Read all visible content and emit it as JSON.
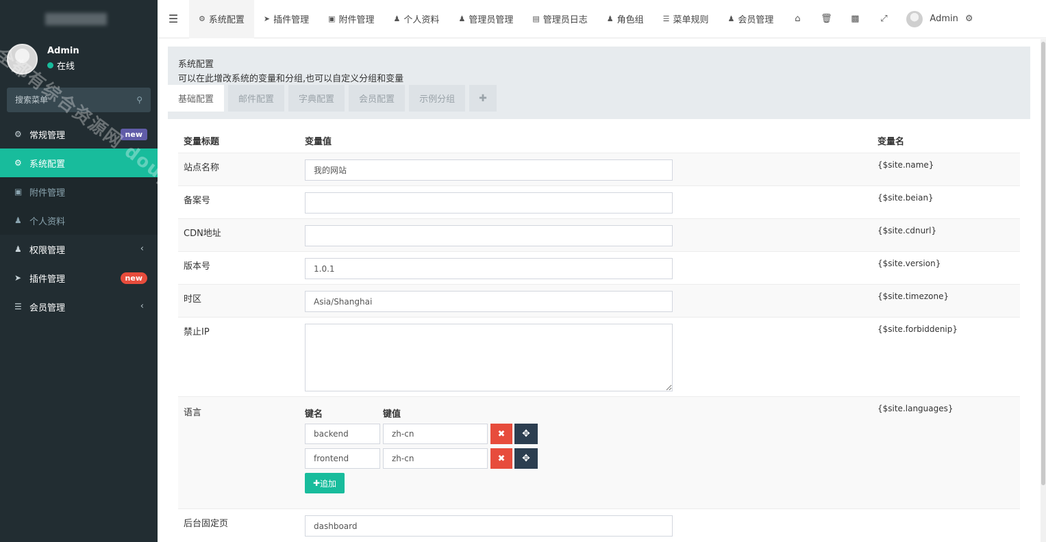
{
  "sidebar": {
    "user": {
      "name": "Admin",
      "status": "在线"
    },
    "search_placeholder": "搜索菜单",
    "items": [
      {
        "label": "常规管理",
        "icon": "cogs-icon",
        "badge": "new"
      },
      {
        "label": "系统配置",
        "icon": "gear-icon"
      },
      {
        "label": "附件管理",
        "icon": "file-image-icon"
      },
      {
        "label": "个人资料",
        "icon": "user-icon"
      },
      {
        "label": "权限管理",
        "icon": "group-icon"
      },
      {
        "label": "插件管理",
        "icon": "rocket-icon",
        "badge": "new"
      },
      {
        "label": "会员管理",
        "icon": "list-icon"
      }
    ],
    "watermark": "全都有综合资源网 douyouvip.com"
  },
  "topnav": {
    "tabs": [
      {
        "label": "系统配置",
        "icon": "gear-icon"
      },
      {
        "label": "插件管理",
        "icon": "rocket-icon"
      },
      {
        "label": "附件管理",
        "icon": "file-image-icon"
      },
      {
        "label": "个人资料",
        "icon": "user-icon"
      },
      {
        "label": "管理员管理",
        "icon": "user-icon"
      },
      {
        "label": "管理员日志",
        "icon": "list-alt-icon"
      },
      {
        "label": "角色组",
        "icon": "group-icon"
      },
      {
        "label": "菜单规则",
        "icon": "bars-icon"
      },
      {
        "label": "会员管理",
        "icon": "user-icon"
      }
    ],
    "user_name": "Admin"
  },
  "page": {
    "title": "系统配置",
    "description": "可以在此增改系统的变量和分组,也可以自定义分组和变量",
    "tabs": [
      "基础配置",
      "邮件配置",
      "字典配置",
      "会员配置",
      "示例分组"
    ]
  },
  "table": {
    "headers": {
      "title": "变量标题",
      "value": "变量值",
      "name": "变量名"
    },
    "rows": [
      {
        "title": "站点名称",
        "value": "我的网站",
        "name": "{$site.name}"
      },
      {
        "title": "备案号",
        "value": "",
        "name": "{$site.beian}"
      },
      {
        "title": "CDN地址",
        "value": "",
        "name": "{$site.cdnurl}"
      },
      {
        "title": "版本号",
        "value": "1.0.1",
        "name": "{$site.version}"
      },
      {
        "title": "时区",
        "value": "Asia/Shanghai",
        "name": "{$site.timezone}"
      },
      {
        "title": "禁止IP",
        "value": "",
        "name": "{$site.forbiddenip}"
      },
      {
        "title": "语言",
        "name": "{$site.languages}"
      },
      {
        "title": "后台固定页",
        "value": "dashboard",
        "name": ""
      }
    ],
    "languages": {
      "key_header": "键名",
      "value_header": "键值",
      "pairs": [
        {
          "key": "backend",
          "value": "zh-cn"
        },
        {
          "key": "frontend",
          "value": "zh-cn"
        }
      ],
      "add_label": "追加"
    }
  },
  "colors": {
    "sidebar_bg": "#222d32",
    "accent": "#18bc9c",
    "danger": "#e74c3c",
    "dark": "#2c3e50",
    "badge_purple": "#605ca8"
  }
}
